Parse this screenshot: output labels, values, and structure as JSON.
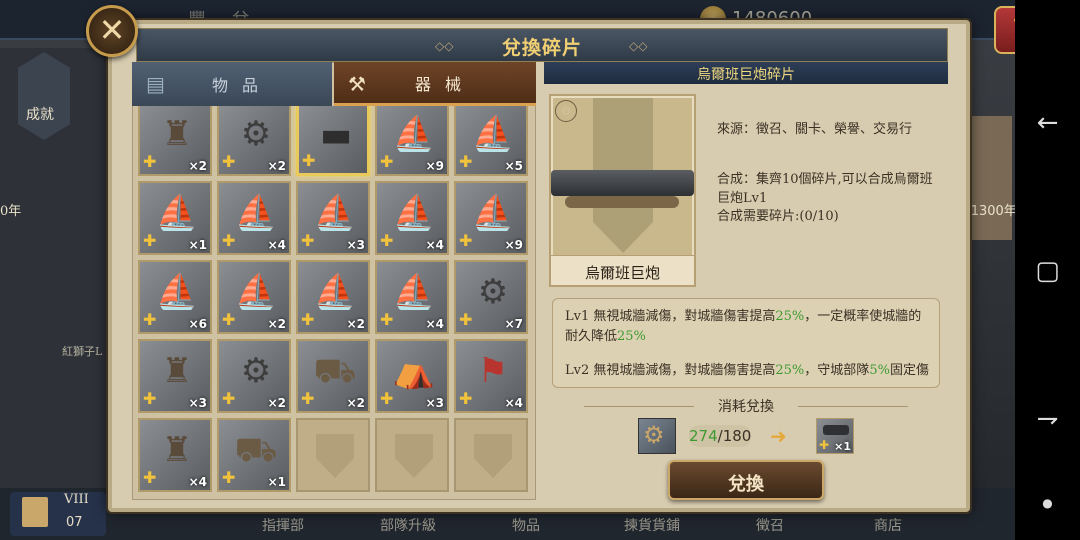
{
  "background": {
    "title": "豐 兌",
    "gold": "1480600",
    "badge_label": "成就",
    "left_label": "0年",
    "right_label": "-1300年",
    "lion_label": "紅獅子L",
    "save_roman": "VIII",
    "save_num": "07",
    "nav": [
      "指揮部",
      "部隊升級",
      "物品",
      "揀貨貨鋪",
      "徵召",
      "商店"
    ]
  },
  "dialog": {
    "title": "兌換碎片",
    "close_icon": "close-icon",
    "tabs": [
      {
        "label": "物品",
        "icon": "item-tab-icon",
        "active": false
      },
      {
        "label": "器械",
        "icon": "machinery-tab-icon",
        "active": true
      }
    ],
    "items": [
      {
        "name": "siege-tower",
        "art": "tower",
        "count": "×2"
      },
      {
        "name": "field-cannon",
        "art": "weapon",
        "count": "×2"
      },
      {
        "name": "great-cannon",
        "art": "cannon",
        "count": "",
        "selected": true
      },
      {
        "name": "galley-ship",
        "art": "ship",
        "count": "×9"
      },
      {
        "name": "sail-ship",
        "art": "ship",
        "count": "×5"
      },
      {
        "name": "small-sailboat",
        "art": "ship",
        "count": "×1"
      },
      {
        "name": "cog-ship",
        "art": "ship",
        "count": "×4"
      },
      {
        "name": "dhow-ship",
        "art": "ship",
        "count": "×3"
      },
      {
        "name": "carrack-ship",
        "art": "ship",
        "count": "×4"
      },
      {
        "name": "galleon-ship",
        "art": "ship",
        "count": "×9"
      },
      {
        "name": "caravel-ship",
        "art": "ship",
        "count": "×6"
      },
      {
        "name": "man-of-war",
        "art": "ship",
        "count": "×2"
      },
      {
        "name": "longship",
        "art": "ship",
        "count": "×2"
      },
      {
        "name": "junk-ship",
        "art": "ship",
        "count": "×4"
      },
      {
        "name": "spike-barricade",
        "art": "weapon",
        "count": "×7"
      },
      {
        "name": "mantlet",
        "art": "tower",
        "count": "×3"
      },
      {
        "name": "caltrops",
        "art": "weapon",
        "count": "×2"
      },
      {
        "name": "covered-wagon",
        "art": "wagon",
        "count": "×2"
      },
      {
        "name": "war-tent",
        "art": "tent",
        "count": "×3"
      },
      {
        "name": "banner-cart",
        "art": "flag",
        "count": "×4"
      },
      {
        "name": "catapult",
        "art": "tower",
        "count": "×4"
      },
      {
        "name": "war-cart",
        "art": "wagon",
        "count": "×1"
      },
      {
        "name": "empty",
        "art": "",
        "count": "",
        "empty": true
      },
      {
        "name": "empty",
        "art": "",
        "count": "",
        "empty": true
      },
      {
        "name": "empty",
        "art": "",
        "count": "",
        "empty": true
      }
    ],
    "detail": {
      "header": "烏爾班巨炮碎片",
      "name": "烏爾班巨炮",
      "source": "來源：徵召、關卡、榮譽、交易行",
      "compose": "合成：集齊10個碎片,可以合成烏爾班巨炮Lv1",
      "need": "合成需要碎片:(0/10)",
      "effects": [
        {
          "pre": "Lv1 無視城牆減傷，對城牆傷害提高",
          "v1": "25%",
          "mid": "，一定概率使城牆的耐久降低",
          "v2": "25%",
          "post": ""
        },
        {
          "pre": "Lv2 無視城牆減傷，對城牆傷害提高",
          "v1": "25%",
          "mid": "，守城部隊",
          "v2": "5%",
          "post": "固定傷"
        }
      ]
    },
    "consume": {
      "label": "消耗兌換",
      "have": "274",
      "need": "/180",
      "result_count": "×1"
    },
    "exchange_label": "兌換"
  },
  "colors": {
    "accent_gold": "#f1cf73",
    "highlight_green": "#3d9a2f",
    "active_tab": "#6e4427"
  }
}
